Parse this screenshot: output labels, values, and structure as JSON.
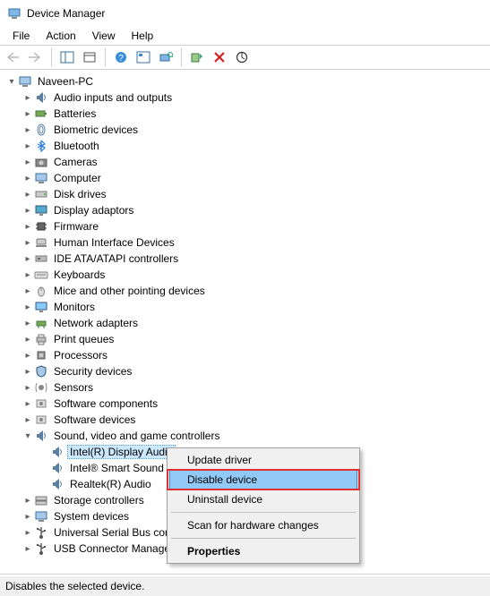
{
  "window": {
    "title": "Device Manager"
  },
  "menu": {
    "items": [
      "File",
      "Action",
      "View",
      "Help"
    ]
  },
  "root": {
    "name": "Naveen-PC"
  },
  "categories": [
    {
      "label": "Audio inputs and outputs",
      "icon": "speaker"
    },
    {
      "label": "Batteries",
      "icon": "battery"
    },
    {
      "label": "Biometric devices",
      "icon": "finger"
    },
    {
      "label": "Bluetooth",
      "icon": "bluetooth"
    },
    {
      "label": "Cameras",
      "icon": "camera"
    },
    {
      "label": "Computer",
      "icon": "computer"
    },
    {
      "label": "Disk drives",
      "icon": "disk"
    },
    {
      "label": "Display adaptors",
      "icon": "display"
    },
    {
      "label": "Firmware",
      "icon": "chip"
    },
    {
      "label": "Human Interface Devices",
      "icon": "hid"
    },
    {
      "label": "IDE ATA/ATAPI controllers",
      "icon": "ide"
    },
    {
      "label": "Keyboards",
      "icon": "keyboard"
    },
    {
      "label": "Mice and other pointing devices",
      "icon": "mouse"
    },
    {
      "label": "Monitors",
      "icon": "monitor"
    },
    {
      "label": "Network adapters",
      "icon": "net"
    },
    {
      "label": "Print queues",
      "icon": "printer"
    },
    {
      "label": "Processors",
      "icon": "cpu"
    },
    {
      "label": "Security devices",
      "icon": "security"
    },
    {
      "label": "Sensors",
      "icon": "sensor"
    },
    {
      "label": "Software components",
      "icon": "soft"
    },
    {
      "label": "Software devices",
      "icon": "soft"
    },
    {
      "label": "Sound, video and game controllers",
      "icon": "speaker",
      "expanded": true,
      "children": [
        {
          "label": "Intel(R) Display Audio",
          "icon": "speaker",
          "selected": true
        },
        {
          "label": "Intel® Smart Sound Technology",
          "icon": "speaker"
        },
        {
          "label": "Realtek(R) Audio",
          "icon": "speaker"
        }
      ]
    },
    {
      "label": "Storage controllers",
      "icon": "storage"
    },
    {
      "label": "System devices",
      "icon": "computer"
    },
    {
      "label": "Universal Serial Bus controllers",
      "icon": "usb"
    },
    {
      "label": "USB Connector Managers",
      "icon": "usb"
    }
  ],
  "context_menu": {
    "items": [
      {
        "label": "Update driver"
      },
      {
        "label": "Disable device",
        "hover": true
      },
      {
        "label": "Uninstall device"
      },
      {
        "sep": true
      },
      {
        "label": "Scan for hardware changes"
      },
      {
        "sep": true
      },
      {
        "label": "Properties",
        "bold": true
      }
    ]
  },
  "status": {
    "text": "Disables the selected device."
  }
}
